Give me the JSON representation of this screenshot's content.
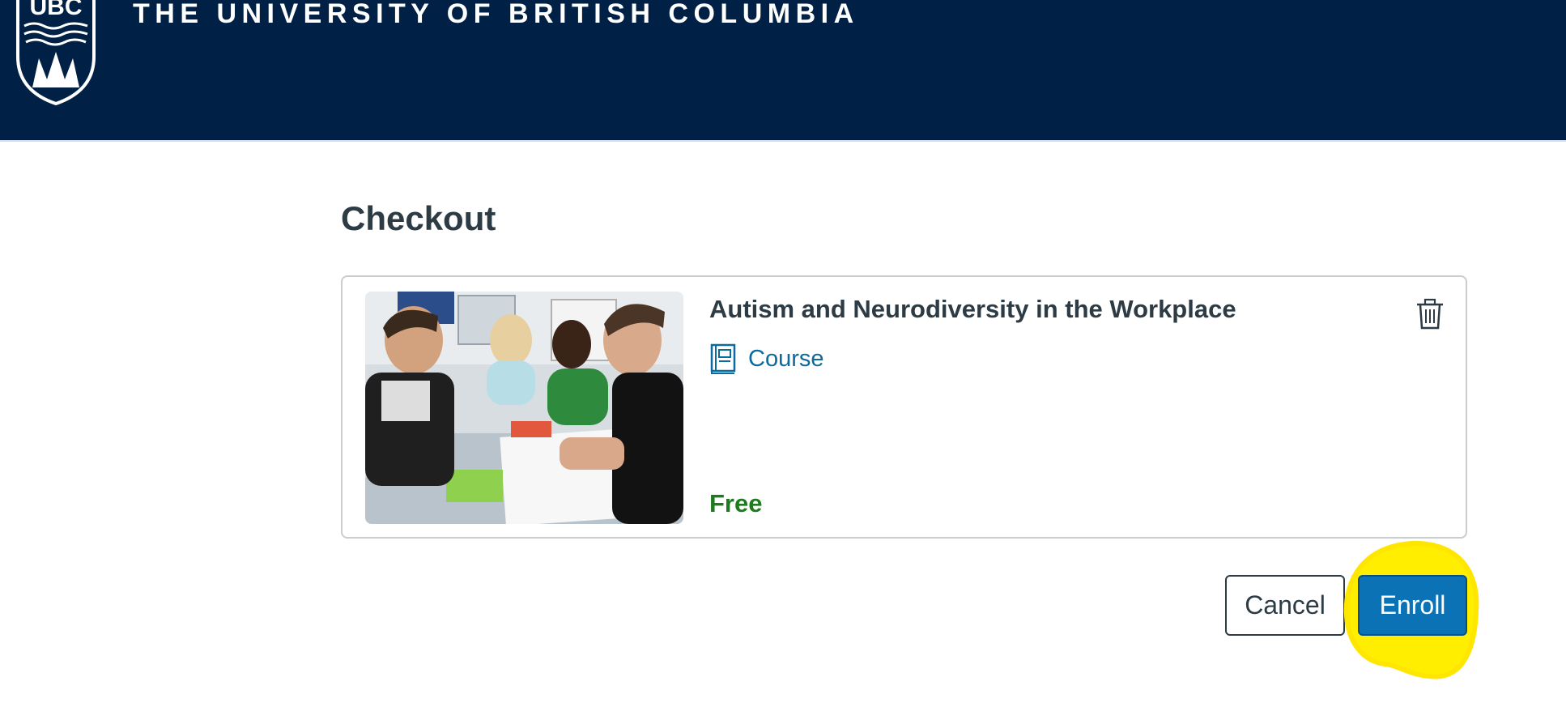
{
  "header": {
    "logo_text": "UBC",
    "university_name": "THE UNIVERSITY OF BRITISH COLUMBIA",
    "logo_icon": "ubc-crest-icon"
  },
  "page": {
    "title": "Checkout"
  },
  "cart_item": {
    "title": "Autism and Neurodiversity in the Workplace",
    "type_label": "Course",
    "type_icon": "course-book-icon",
    "price": "Free",
    "remove_icon": "trash-icon",
    "image": "course-photo"
  },
  "actions": {
    "cancel_label": "Cancel",
    "enroll_label": "Enroll"
  },
  "colors": {
    "header_bg": "#002145",
    "link": "#0b6a9f",
    "price": "#1f7a1f",
    "primary_button": "#0b72b5",
    "highlight": "#ffee00"
  }
}
